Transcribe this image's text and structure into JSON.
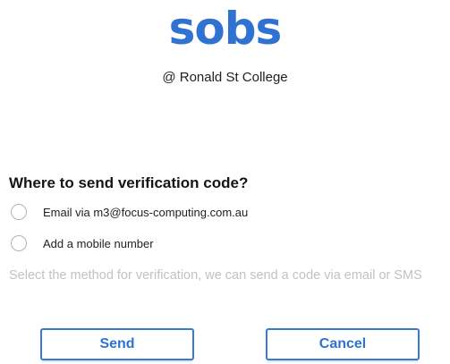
{
  "header": {
    "logo_text": "sobs",
    "school": "@ Ronald St College"
  },
  "verification": {
    "heading": "Where to send verification code?",
    "options": [
      {
        "label": "Email via m3@focus-computing.com.au",
        "selected": false
      },
      {
        "label": "Add a mobile number",
        "selected": false
      }
    ],
    "hint": "Select the method for verification, we can send a code via email or SMS"
  },
  "actions": {
    "send_label": "Send",
    "cancel_label": "Cancel"
  },
  "colors": {
    "brand": "#2f72d2",
    "hint_text": "#c2c2c2",
    "radio_border": "#b3b3b3"
  }
}
